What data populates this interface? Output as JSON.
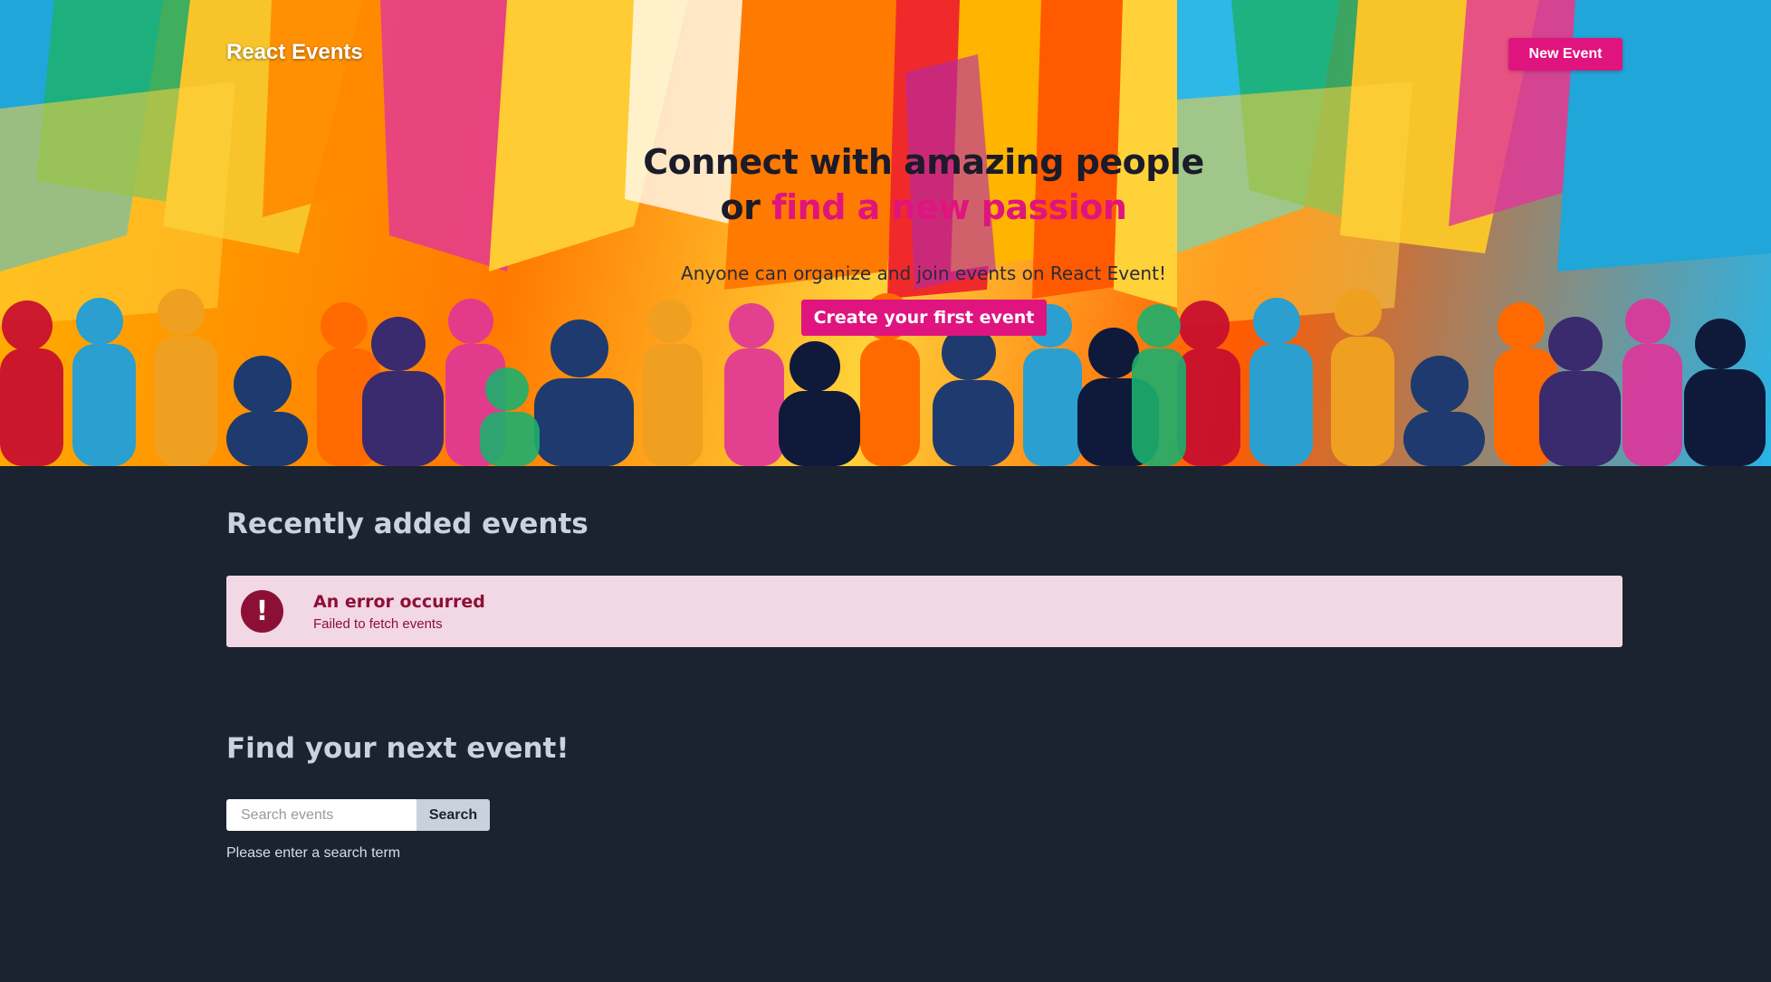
{
  "nav": {
    "brand": "React Events",
    "new_event_label": "New Event"
  },
  "hero": {
    "headline_line1": "Connect with amazing people",
    "headline_or": "or",
    "headline_accent": "find a new passion",
    "subline": "Anyone can organize and join events on React Event!",
    "cta_label": "Create your first event"
  },
  "recent": {
    "title": "Recently added events",
    "error_title": "An error occurred",
    "error_message": "Failed to fetch events",
    "error_icon": "!"
  },
  "find": {
    "title": "Find your next event!",
    "search_placeholder": "Search events",
    "search_button": "Search",
    "hint": "Please enter a search term"
  },
  "colors": {
    "accent": "#e0147f",
    "background": "#1b2230",
    "error_bg": "#f2d7e4",
    "error_text": "#8c1036"
  }
}
